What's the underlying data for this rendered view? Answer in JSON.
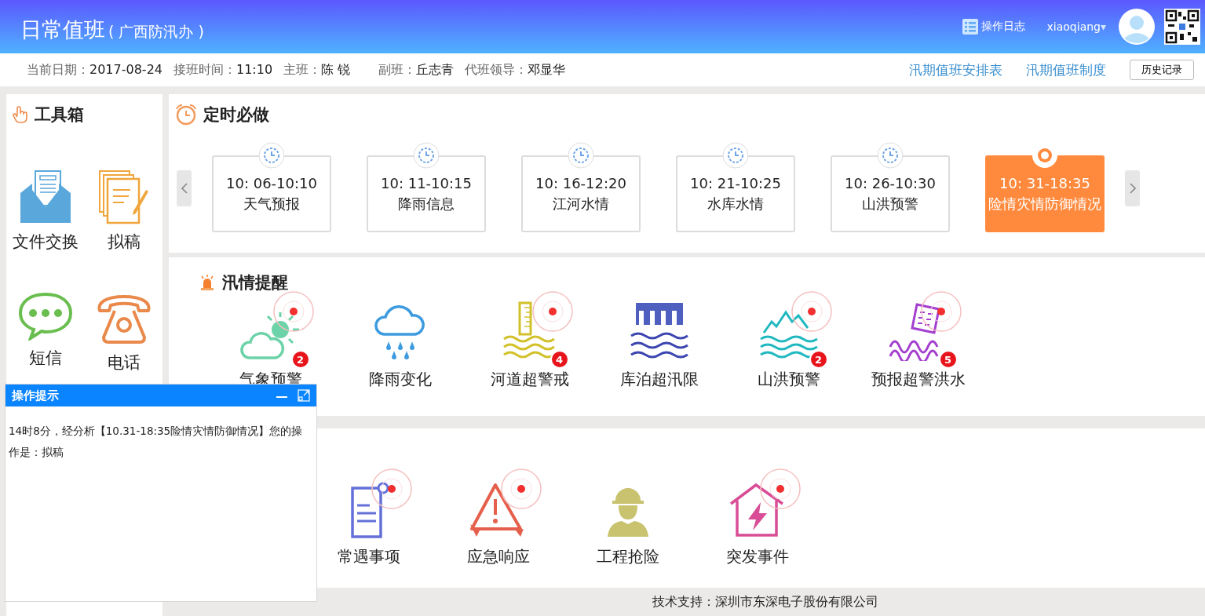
{
  "header": {
    "title": "日常值班",
    "subtitle": "( 广西防汛办 )",
    "log_button": "操作日志",
    "user": "xiaoqiang",
    "user_caret": "▾"
  },
  "info": {
    "items": [
      {
        "label": "当前日期：",
        "value": "2017-08-24"
      },
      {
        "label": "接班时间：",
        "value": "11:10"
      },
      {
        "label": "主班：",
        "value": "陈 锐"
      },
      {
        "label": "副班：",
        "value": "丘志青"
      },
      {
        "label": "代班领导：",
        "value": "邓显华"
      }
    ],
    "links": [
      "汛期值班安排表",
      "汛期值班制度"
    ],
    "history_button": "历史记录"
  },
  "toolbox": {
    "title": "工具箱",
    "tools": [
      {
        "kind": "envelope",
        "label": "文件交换"
      },
      {
        "kind": "draft",
        "label": "拟稿"
      },
      {
        "kind": "message",
        "label": "短信"
      },
      {
        "kind": "phone",
        "label": "电话"
      }
    ]
  },
  "schedule": {
    "title": "定时必做",
    "items": [
      {
        "time": "10: 06-10:10",
        "name": "天气预报",
        "selected": false
      },
      {
        "time": "10: 11-10:15",
        "name": "降雨信息",
        "selected": false
      },
      {
        "time": "10: 16-12:20",
        "name": "江河水情",
        "selected": false
      },
      {
        "time": "10: 21-10:25",
        "name": "水库水情",
        "selected": false
      },
      {
        "time": "10: 26-10:30",
        "name": "山洪预警",
        "selected": false
      },
      {
        "time": "10: 31-18:35",
        "name": "险情灾情防御情况",
        "selected": true
      }
    ]
  },
  "alerts": {
    "title": "汛情提醒",
    "items": [
      {
        "kind": "weather",
        "label": "气象预警",
        "alerting": true,
        "badge": "2"
      },
      {
        "kind": "rain",
        "label": "降雨变化",
        "alerting": false
      },
      {
        "kind": "river",
        "label": "河道超警戒",
        "alerting": true,
        "badge": "4"
      },
      {
        "kind": "lake",
        "label": "库泊超汛限",
        "alerting": false
      },
      {
        "kind": "mountain",
        "label": "山洪预警",
        "alerting": true,
        "badge": "2"
      },
      {
        "kind": "forecast",
        "label": "预报超警洪水",
        "alerting": true,
        "badge": "5"
      }
    ]
  },
  "events": {
    "items": [
      {
        "kind": "document",
        "label": "常遇事项",
        "alerting": true
      },
      {
        "kind": "warning",
        "label": "应急响应",
        "alerting": true
      },
      {
        "kind": "worker",
        "label": "工程抢险",
        "alerting": false
      },
      {
        "kind": "house",
        "label": "突发事件",
        "alerting": true
      }
    ]
  },
  "popup": {
    "title": "操作提示",
    "message": "14时8分，经分析【10.31-18:35险情灾情防御情况】您的操作是：拟稿"
  },
  "footer": "技术支持：深圳市东深电子股份有限公司"
}
